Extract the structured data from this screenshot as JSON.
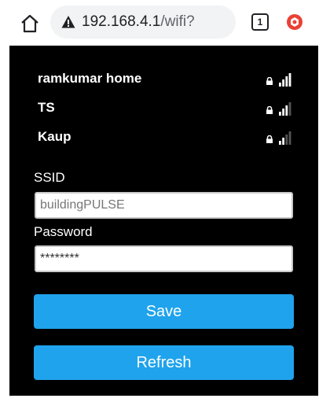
{
  "browser": {
    "url_host": "192.168.4.1",
    "url_path": "/wifi?",
    "tab_count": "1",
    "icons": {
      "home": "home-icon",
      "security": "warning-triangle-icon",
      "extension": "red-hexagon-icon"
    }
  },
  "networks": [
    {
      "name": "ramkumar home",
      "signal_bars": 4,
      "secured": true
    },
    {
      "name": "TS",
      "signal_bars": 3,
      "secured": true
    },
    {
      "name": "Kaup",
      "signal_bars": 2,
      "secured": true
    }
  ],
  "form": {
    "ssid_label": "SSID",
    "ssid_value": "buildingPULSE",
    "password_label": "Password",
    "password_value": "********",
    "save_label": "Save",
    "refresh_label": "Refresh"
  },
  "colors": {
    "panel_bg": "#000000",
    "button_bg": "#1fa3ec",
    "button_text": "#ffffff",
    "signal_active": "#ffffff",
    "signal_inactive": "#555555"
  }
}
